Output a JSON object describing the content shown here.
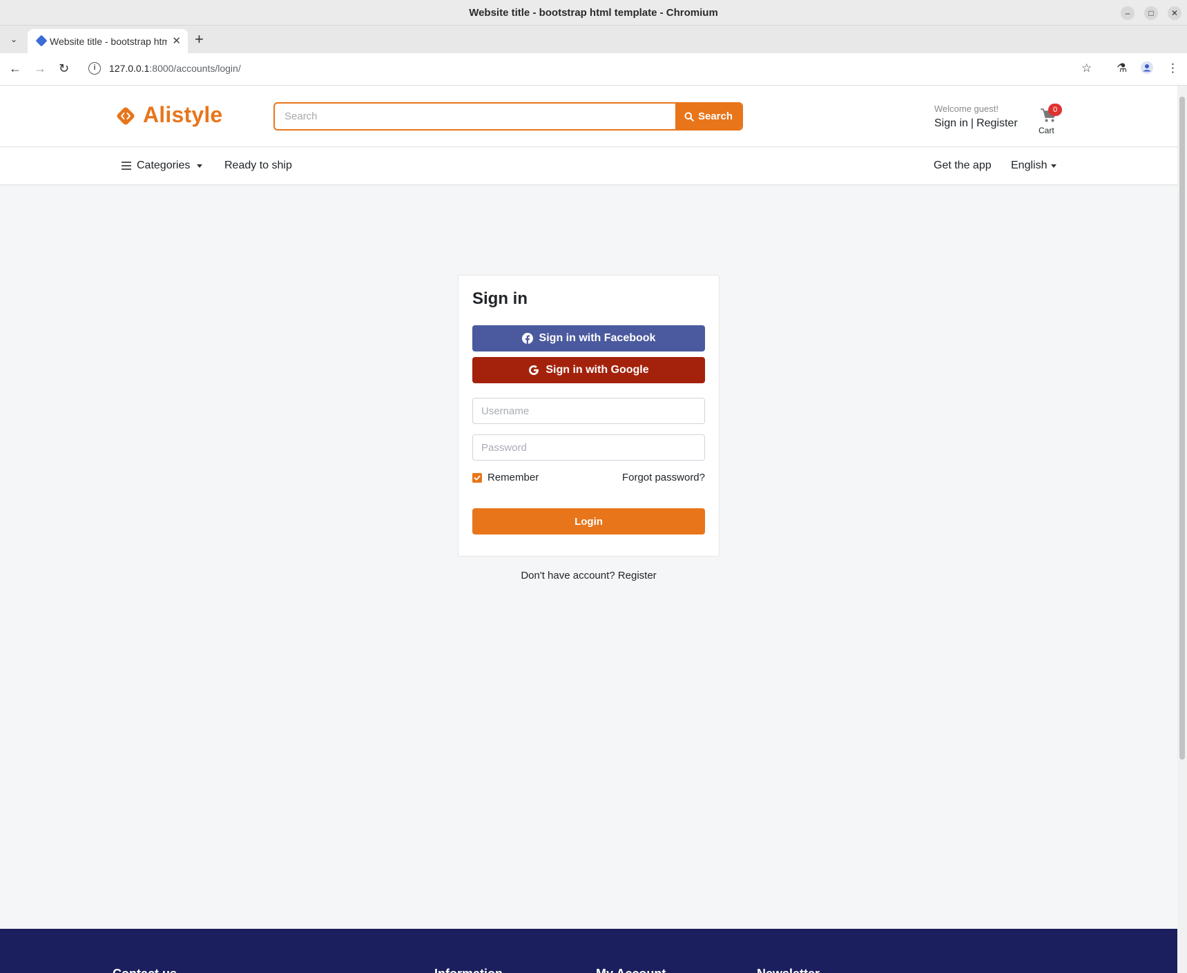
{
  "browser": {
    "window_title": "Website title - bootstrap html template - Chromium",
    "tab_title": "Website title - bootstrap html template",
    "url_host": "127.0.0.1",
    "url_rest": ":8000/accounts/login/"
  },
  "header": {
    "logo_text": "Alistyle",
    "search_placeholder": "Search",
    "search_button": "Search",
    "welcome": "Welcome guest!",
    "signin_link": "Sign in",
    "separator": "|",
    "register_link": "Register",
    "cart_count": "0",
    "cart_label": "Cart"
  },
  "nav": {
    "categories": "Categories",
    "ready_to_ship": "Ready to ship",
    "get_app": "Get the app",
    "language": "English"
  },
  "signin": {
    "title": "Sign in",
    "facebook_button": "Sign in with Facebook",
    "google_button": "Sign in with Google",
    "username_placeholder": "Username",
    "password_placeholder": "Password",
    "remember_label": "Remember",
    "remember_checked": true,
    "forgot_link": "Forgot password?",
    "login_button": "Login",
    "no_account_text": "Don't have account?",
    "register_link": "Register"
  },
  "footer": {
    "headings": [
      "Contact us",
      "Information",
      "My Account",
      "Newsletter"
    ]
  },
  "colors": {
    "brand": "#e8751a",
    "facebook": "#4b5a9e",
    "google": "#a4220c",
    "footer_bg": "#1b1f5e",
    "badge": "#e03131"
  }
}
